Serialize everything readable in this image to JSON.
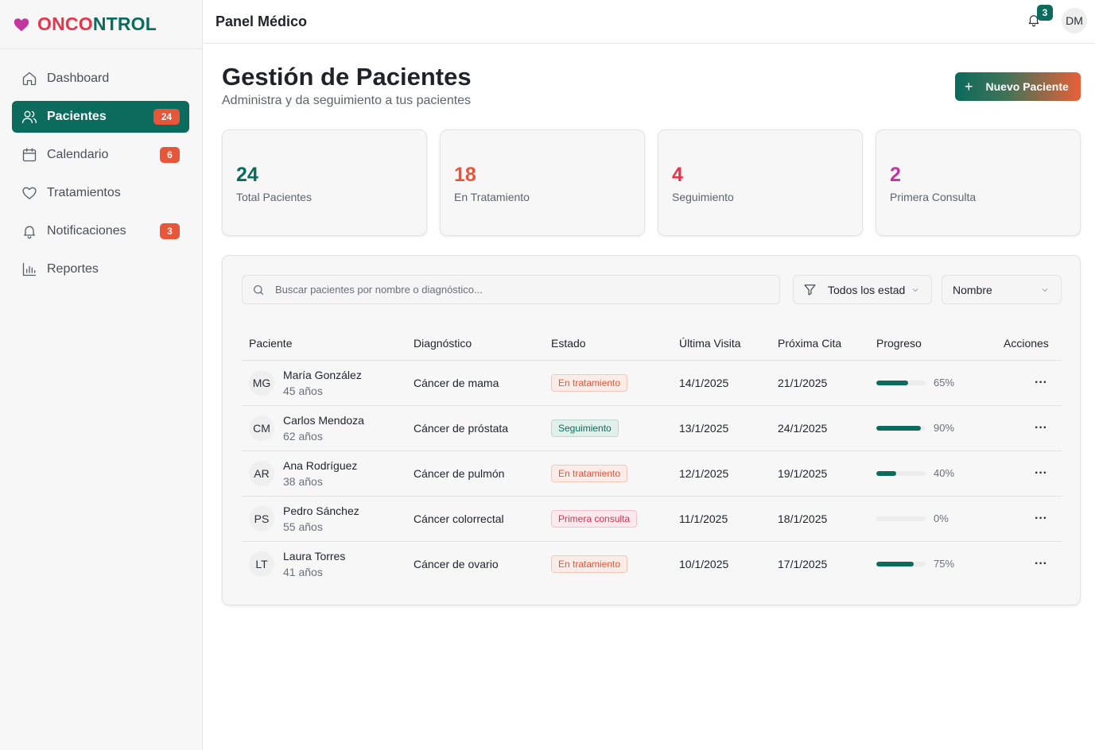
{
  "brand": {
    "name_part1": "ONCO",
    "name_part2": "NTROL",
    "logo_icon": "heart-icon"
  },
  "sidebar": {
    "items": [
      {
        "label": "Dashboard",
        "icon": "home-icon",
        "badge": null,
        "active": false
      },
      {
        "label": "Pacientes",
        "icon": "users-icon",
        "badge": "24",
        "active": true
      },
      {
        "label": "Calendario",
        "icon": "calendar-icon",
        "badge": "6",
        "active": false
      },
      {
        "label": "Tratamientos",
        "icon": "heart-outline-icon",
        "badge": null,
        "active": false
      },
      {
        "label": "Notificaciones",
        "icon": "bell-icon",
        "badge": "3",
        "active": false
      },
      {
        "label": "Reportes",
        "icon": "bar-chart-icon",
        "badge": null,
        "active": false
      }
    ]
  },
  "topbar": {
    "title": "Panel Médico",
    "notification_count": "3",
    "user_initials": "DM"
  },
  "header": {
    "title": "Gestión de Pacientes",
    "subtitle": "Administra y da seguimiento a tus pacientes",
    "new_button_label": "Nuevo Paciente"
  },
  "stats": [
    {
      "value": "24",
      "label": "Total Pacientes",
      "color": "#0b6b5c"
    },
    {
      "value": "18",
      "label": "En Tratamiento",
      "color": "#e8563a"
    },
    {
      "value": "4",
      "label": "Seguimiento",
      "color": "#e6364c"
    },
    {
      "value": "2",
      "label": "Primera Consulta",
      "color": "#c236a0"
    }
  ],
  "filters": {
    "search_placeholder": "Buscar pacientes por nombre o diagnóstico...",
    "status_value": "Todos los estados",
    "sort_value": "Nombre"
  },
  "table": {
    "headers": [
      "Paciente",
      "Diagnóstico",
      "Estado",
      "Última Visita",
      "Próxima Cita",
      "Progreso",
      "Acciones"
    ],
    "rows": [
      {
        "initials": "MG",
        "name": "María González",
        "age": "45 años",
        "diagnosis": "Cáncer de mama",
        "status": "En tratamiento",
        "status_type": "trat",
        "last_visit": "14/1/2025",
        "next_visit": "21/1/2025",
        "progress": 65,
        "progress_label": "65%"
      },
      {
        "initials": "CM",
        "name": "Carlos Mendoza",
        "age": "62 años",
        "diagnosis": "Cáncer de próstata",
        "status": "Seguimiento",
        "status_type": "seg",
        "last_visit": "13/1/2025",
        "next_visit": "24/1/2025",
        "progress": 90,
        "progress_label": "90%"
      },
      {
        "initials": "AR",
        "name": "Ana Rodríguez",
        "age": "38 años",
        "diagnosis": "Cáncer de pulmón",
        "status": "En tratamiento",
        "status_type": "trat",
        "last_visit": "12/1/2025",
        "next_visit": "19/1/2025",
        "progress": 40,
        "progress_label": "40%"
      },
      {
        "initials": "PS",
        "name": "Pedro Sánchez",
        "age": "55 años",
        "diagnosis": "Cáncer colorrectal",
        "status": "Primera consulta",
        "status_type": "prim",
        "last_visit": "11/1/2025",
        "next_visit": "18/1/2025",
        "progress": 0,
        "progress_label": "0%"
      },
      {
        "initials": "LT",
        "name": "Laura Torres",
        "age": "41 años",
        "diagnosis": "Cáncer de ovario",
        "status": "En tratamiento",
        "status_type": "trat",
        "last_visit": "10/1/2025",
        "next_visit": "17/1/2025",
        "progress": 75,
        "progress_label": "75%"
      }
    ],
    "action_icon": "more-horizontal-icon",
    "action_glyph": "···"
  }
}
